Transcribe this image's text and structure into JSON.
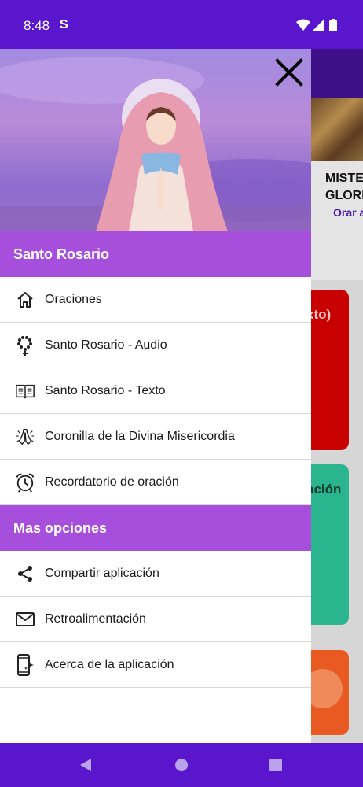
{
  "status_bar": {
    "time": "8:48",
    "notification_icon": "S"
  },
  "background_app": {
    "card_title_lines": [
      "MISTE",
      "GLORIC"
    ],
    "card_link": "Orar a",
    "tile_red_text": "xto)",
    "tile_green_text": "ación"
  },
  "drawer": {
    "header_image": "virgin-mary-praying-image",
    "sections": [
      {
        "title": "Santo Rosario",
        "items": [
          {
            "label": "Oraciones",
            "icon": "home-icon"
          },
          {
            "label": "Santo Rosario - Audio",
            "icon": "rosary-icon"
          },
          {
            "label": "Santo Rosario - Texto",
            "icon": "open-book-icon"
          },
          {
            "label": "Coronilla de la Divina Misericordia",
            "icon": "praying-hands-icon"
          },
          {
            "label": "Recordatorio de oración",
            "icon": "alarm-clock-icon"
          }
        ]
      },
      {
        "title": "Mas opciones",
        "items": [
          {
            "label": "Compartir aplicación",
            "icon": "share-icon"
          },
          {
            "label": "Retroalimentación",
            "icon": "mail-icon"
          },
          {
            "label": "Acerca de la aplicación",
            "icon": "app-info-icon"
          }
        ]
      }
    ]
  },
  "colors": {
    "status_bar": "#5a16cc",
    "section_header": "#a64fdc",
    "bg_red_tile": "#c80000",
    "bg_green_tile": "#2ab58f",
    "bg_orange_tile": "#e85a22"
  }
}
